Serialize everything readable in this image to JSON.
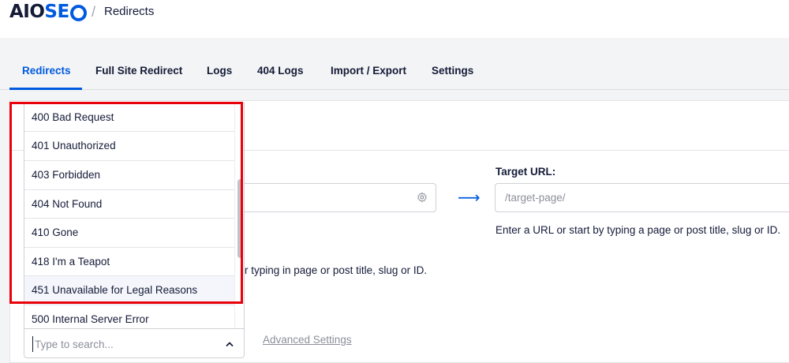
{
  "header": {
    "logo_main": "AIO",
    "logo_accent": "SE",
    "separator": "/",
    "breadcrumb": "Redirects"
  },
  "tabs": [
    {
      "label": "Redirects"
    },
    {
      "label": "Full Site Redirect"
    },
    {
      "label": "Logs"
    },
    {
      "label": "404 Logs"
    },
    {
      "label": "Import / Export"
    },
    {
      "label": "Settings"
    }
  ],
  "form": {
    "target_label": "Target URL:",
    "target_placeholder": "/target-page/",
    "target_help": "Enter a URL or start by typing a page or post title, slug or ID.",
    "source_help_fragment": "r typing in page or post title, slug or ID.",
    "arrow": "⟶",
    "advanced_link": "Advanced Settings"
  },
  "dropdown": {
    "options": [
      {
        "label": "400 Bad Request"
      },
      {
        "label": "401 Unauthorized"
      },
      {
        "label": "403 Forbidden"
      },
      {
        "label": "404 Not Found"
      },
      {
        "label": "410 Gone"
      },
      {
        "label": "418 I'm a Teapot"
      },
      {
        "label": "451 Unavailable for Legal Reasons"
      },
      {
        "label": "500 Internal Server Error"
      }
    ],
    "search_placeholder": "Type to search..."
  },
  "colors": {
    "accent": "#005ae0",
    "highlight": "#e8000b",
    "text": "#141b38"
  }
}
